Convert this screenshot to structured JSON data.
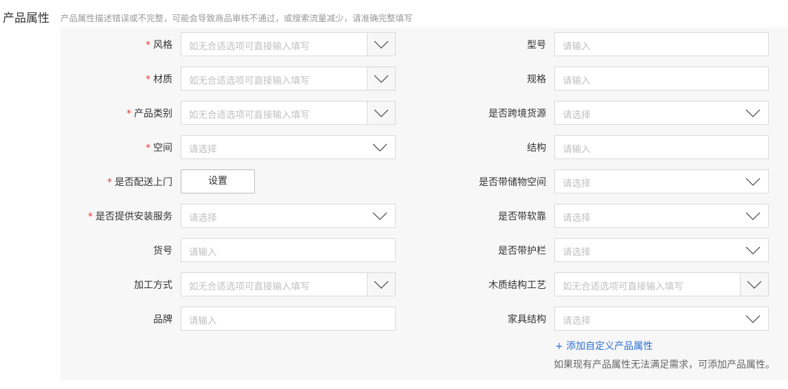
{
  "section": {
    "title": "产品属性",
    "hint": "产品属性描述错误或不完整，可能会导致商品审核不通过，或搜索流量减少，请准确完整填写"
  },
  "left": [
    {
      "label": "风格",
      "required": true,
      "type": "combo",
      "placeholder": "如无合适选项可直接输入填写"
    },
    {
      "label": "材质",
      "required": true,
      "type": "combo",
      "placeholder": "如无合适选项可直接输入填写"
    },
    {
      "label": "产品类别",
      "required": true,
      "type": "combo",
      "placeholder": "如无合适选项可直接输入填写"
    },
    {
      "label": "空间",
      "required": true,
      "type": "select",
      "placeholder": "请选择"
    },
    {
      "label": "是否配送上门",
      "required": true,
      "type": "button",
      "button_label": "设置"
    },
    {
      "label": "是否提供安装服务",
      "required": true,
      "type": "select",
      "placeholder": "请选择"
    },
    {
      "label": "货号",
      "required": false,
      "type": "input",
      "placeholder": "请输入"
    },
    {
      "label": "加工方式",
      "required": false,
      "type": "combo",
      "placeholder": "如无合适选项可直接输入填写"
    },
    {
      "label": "品牌",
      "required": false,
      "type": "input",
      "placeholder": "请输入"
    }
  ],
  "right": [
    {
      "label": "型号",
      "required": false,
      "type": "input",
      "placeholder": "请输入"
    },
    {
      "label": "规格",
      "required": false,
      "type": "input",
      "placeholder": "请输入"
    },
    {
      "label": "是否跨境货源",
      "required": false,
      "type": "select",
      "placeholder": "请选择"
    },
    {
      "label": "结构",
      "required": false,
      "type": "input",
      "placeholder": "请输入"
    },
    {
      "label": "是否带储物空间",
      "required": false,
      "type": "select",
      "placeholder": "请选择"
    },
    {
      "label": "是否带软靠",
      "required": false,
      "type": "select",
      "placeholder": "请选择"
    },
    {
      "label": "是否带护栏",
      "required": false,
      "type": "select",
      "placeholder": "请选择"
    },
    {
      "label": "木质结构工艺",
      "required": false,
      "type": "combo",
      "placeholder": "如无合适选项可直接输入填写"
    },
    {
      "label": "家具结构",
      "required": false,
      "type": "select",
      "placeholder": "请选择"
    }
  ],
  "required_mark": "*",
  "custom": {
    "add_link": "+ 添加自定义产品属性",
    "note": "如果现有产品属性无法满足需求，可添加产品属性。"
  },
  "icons": {
    "dropdown": "chevron-down-icon"
  },
  "colors": {
    "required": "#e4393c",
    "link": "#2a6fd6",
    "panel_bg": "#f7f7f7"
  }
}
